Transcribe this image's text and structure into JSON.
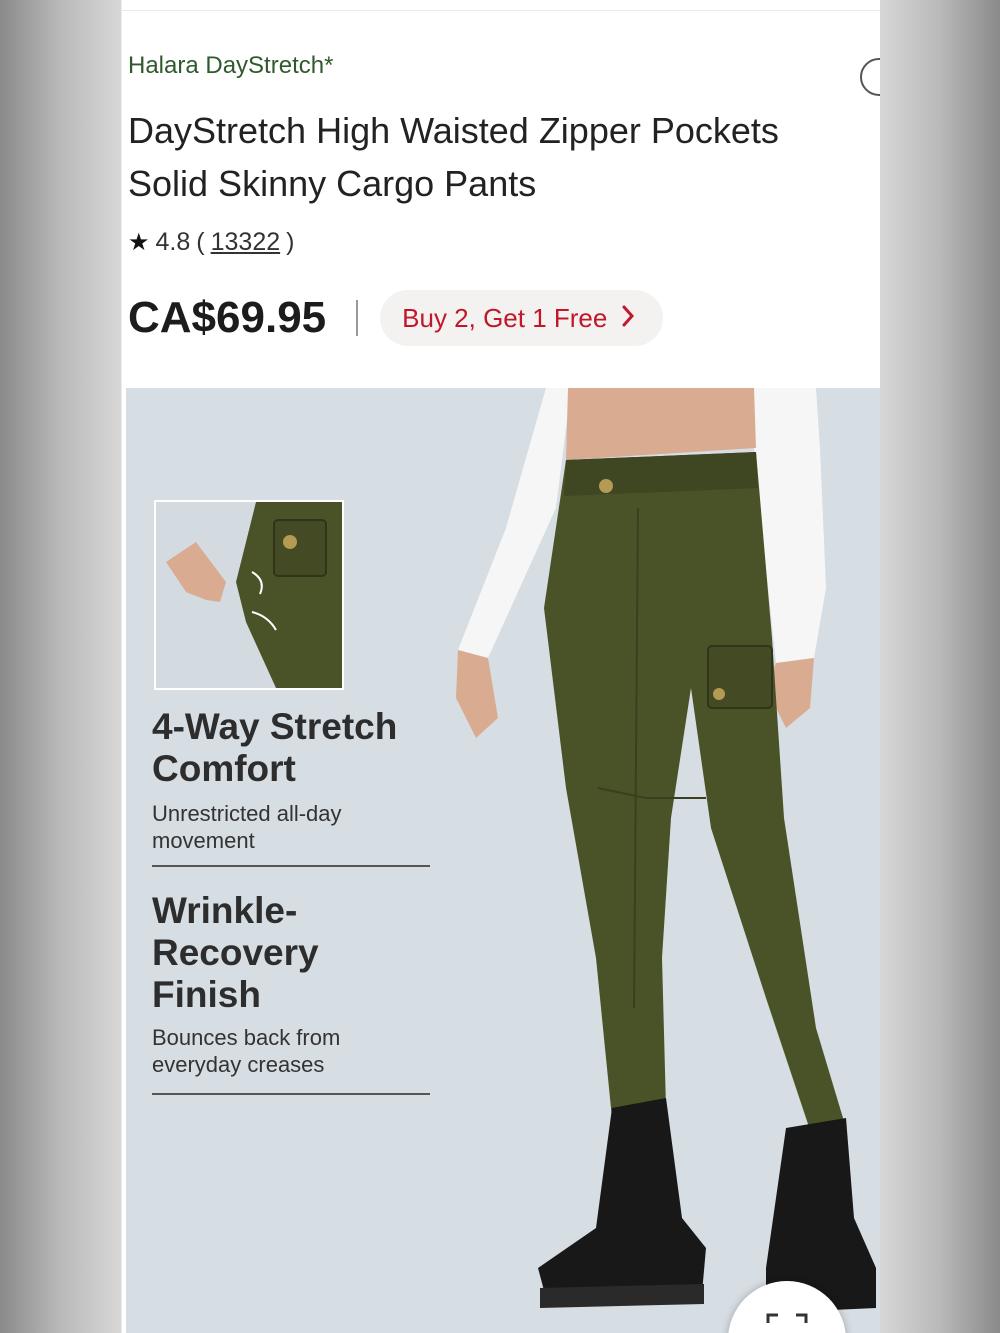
{
  "product": {
    "brand": "Halara DayStretch*",
    "title": "DayStretch High Waisted Zipper Pockets Solid Skinny Cargo Pants",
    "rating": "4.8",
    "review_count": "13322",
    "price": "CA$69.95",
    "promo": "Buy 2, Get 1 Free"
  },
  "features": [
    {
      "title": "4-Way Stretch Comfort",
      "subtitle": "Unrestricted all-day movement"
    },
    {
      "title": "Wrinkle-Recovery Finish",
      "subtitle": "Bounces back from everyday creases"
    }
  ],
  "icons": {
    "star": "star-icon",
    "promo_chevron": "chevron-right-icon",
    "side_button": "circle-arrow-icon",
    "scan": "scan-icon"
  },
  "colors": {
    "brand_green": "#2f5a2f",
    "promo_red": "#c0182a",
    "hero_bg": "#d6dde3",
    "pants_olive": "#4a5228"
  }
}
